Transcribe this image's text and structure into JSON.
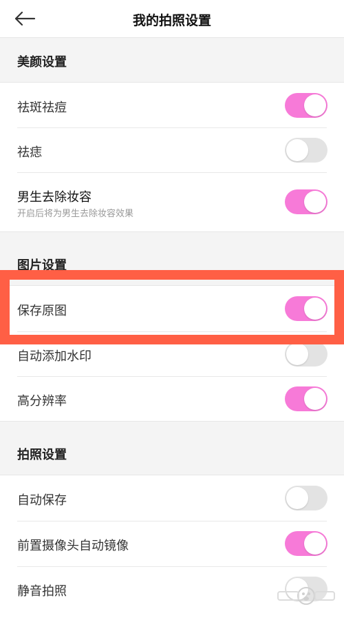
{
  "header": {
    "title": "我的拍照设置",
    "back_icon": "arrow-left-icon"
  },
  "colors": {
    "accent": "#f77ad8",
    "highlight": "#ff5f45",
    "toggle_off": "#e3e3e3"
  },
  "sections": [
    {
      "title": "美颜设置",
      "rows": [
        {
          "label": "祛斑祛痘",
          "on": true
        },
        {
          "label": "祛痣",
          "on": false
        },
        {
          "label": "男生去除妆容",
          "sub": "开启后将为男生去除妆容效果",
          "on": true
        }
      ]
    },
    {
      "title": "图片设置",
      "rows": [
        {
          "label": "保存原图",
          "on": true
        },
        {
          "label": "自动添加水印",
          "on": false
        },
        {
          "label": "高分辨率",
          "on": true
        }
      ]
    },
    {
      "title": "拍照设置",
      "rows": [
        {
          "label": "自动保存",
          "on": false
        },
        {
          "label": "前置摄像头自动镜像",
          "on": true
        },
        {
          "label": "静音拍照",
          "on": false
        }
      ]
    }
  ]
}
